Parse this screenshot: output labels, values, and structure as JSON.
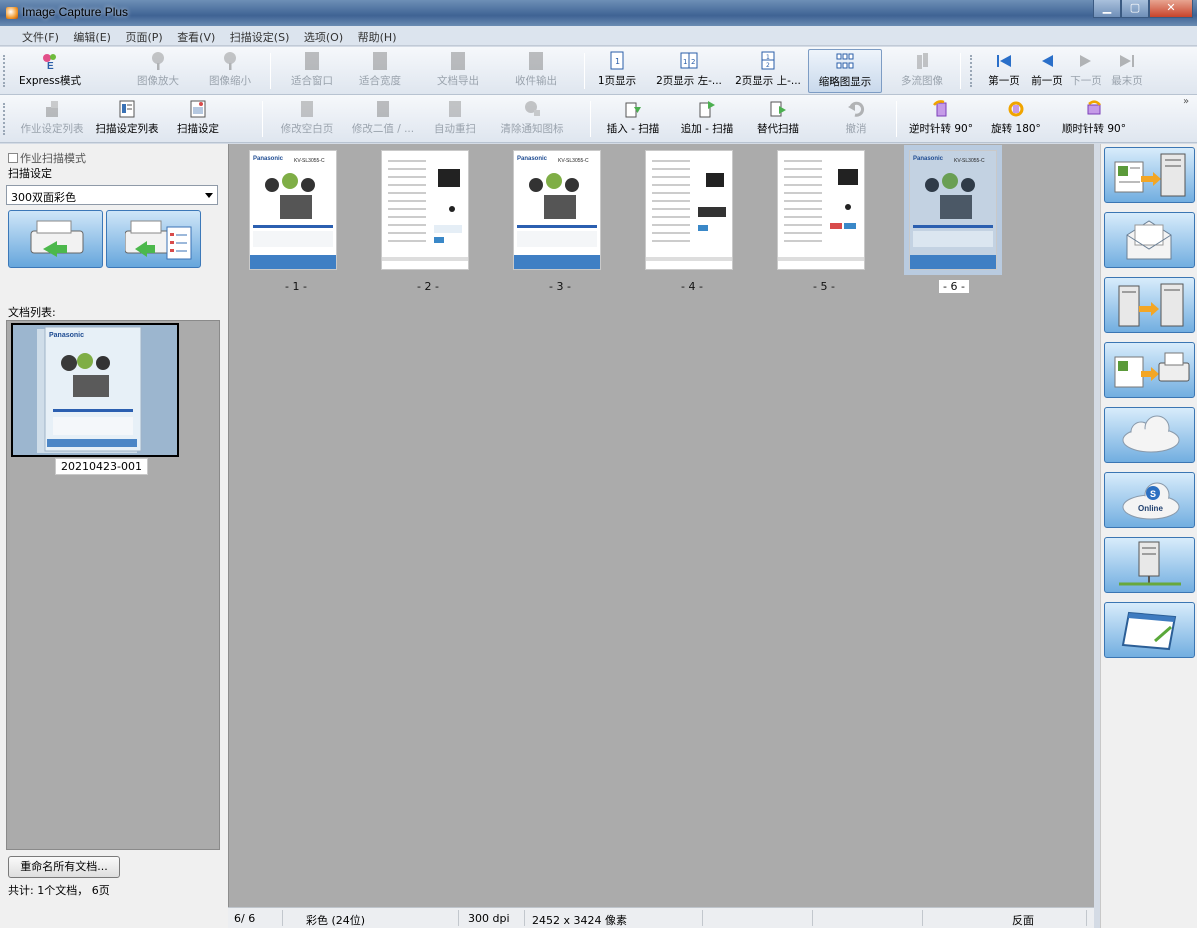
{
  "window": {
    "title": "Image Capture Plus",
    "btn_min": "▁",
    "btn_max": "▢",
    "btn_close": "✕"
  },
  "menu": [
    "文件(F)",
    "编辑(E)",
    "页面(P)",
    "查看(V)",
    "扫描设定(S)",
    "选项(O)",
    "帮助(H)"
  ],
  "toolbar1": {
    "express": "Express模式",
    "zoom_in": "图像放大",
    "zoom_out": "图像缩小",
    "fit_window": "适合窗口",
    "fit_width": "适合宽度",
    "doc_export": "文档导出",
    "fax_output": "收件输出",
    "one_page": "1页显示",
    "two_page_lr": "2页显示 左-...",
    "two_page_tb": "2页显示 上-...",
    "thumbnail": "缩略图显示",
    "multi_stream": "多流图像",
    "first_page": "第一页",
    "prev_page": "前一页",
    "next_page": "下一页",
    "last_page": "最末页"
  },
  "toolbar2": {
    "job_list": "作业设定列表",
    "scan_list": "扫描设定列表",
    "scan_setting": "扫描设定",
    "edit_blank": "修改空白页",
    "edit_binary": "修改二值 / ...",
    "auto_rescan": "自动重扫",
    "clear_notice": "清除通知图标",
    "insert_scan": "插入 - 扫描",
    "append_scan": "追加 - 扫描",
    "replace_scan": "替代扫描",
    "undo": "撤消",
    "rotate_ccw": "逆时针转 90°",
    "rotate_180": "旋转 180°",
    "rotate_cw": "顺时针转 90°",
    "overflow": "»"
  },
  "left": {
    "job_mode": "作业扫描模式",
    "scan_label": "扫描设定",
    "scan_value": "300双面彩色",
    "doc_list_label": "文档列表:",
    "doc_name": "20210423-001",
    "rename_button": "重命名所有文档...",
    "total": "共计:  1个文档，   6页"
  },
  "pages": [
    {
      "label": "- 1 -",
      "brand": "Panasonic",
      "model": "KV-SL3055-C"
    },
    {
      "label": "- 2 -",
      "brand": "",
      "model": ""
    },
    {
      "label": "- 3 -",
      "brand": "Panasonic",
      "model": "KV-SL3055-C"
    },
    {
      "label": "- 4 -",
      "brand": "",
      "model": ""
    },
    {
      "label": "- 5 -",
      "brand": "",
      "model": ""
    },
    {
      "label": "- 6 -",
      "brand": "Panasonic",
      "model": "KV-SL3055-C"
    }
  ],
  "selected_page": 6,
  "status": {
    "page": "6/  6",
    "color": "彩色 (24位)",
    "dpi": "300 dpi",
    "size": "2452 x  3424 像素",
    "side": "反面"
  },
  "right_buttons": [
    "send-to-server",
    "send-to-email",
    "send-to-folder",
    "send-to-printer",
    "send-to-cloud",
    "send-to-sharepoint-online",
    "send-to-ftp",
    "send-to-app"
  ],
  "colors": {
    "accent": "#3b76b3",
    "selection": "#b9cbe0",
    "workspace": "#ababab"
  }
}
